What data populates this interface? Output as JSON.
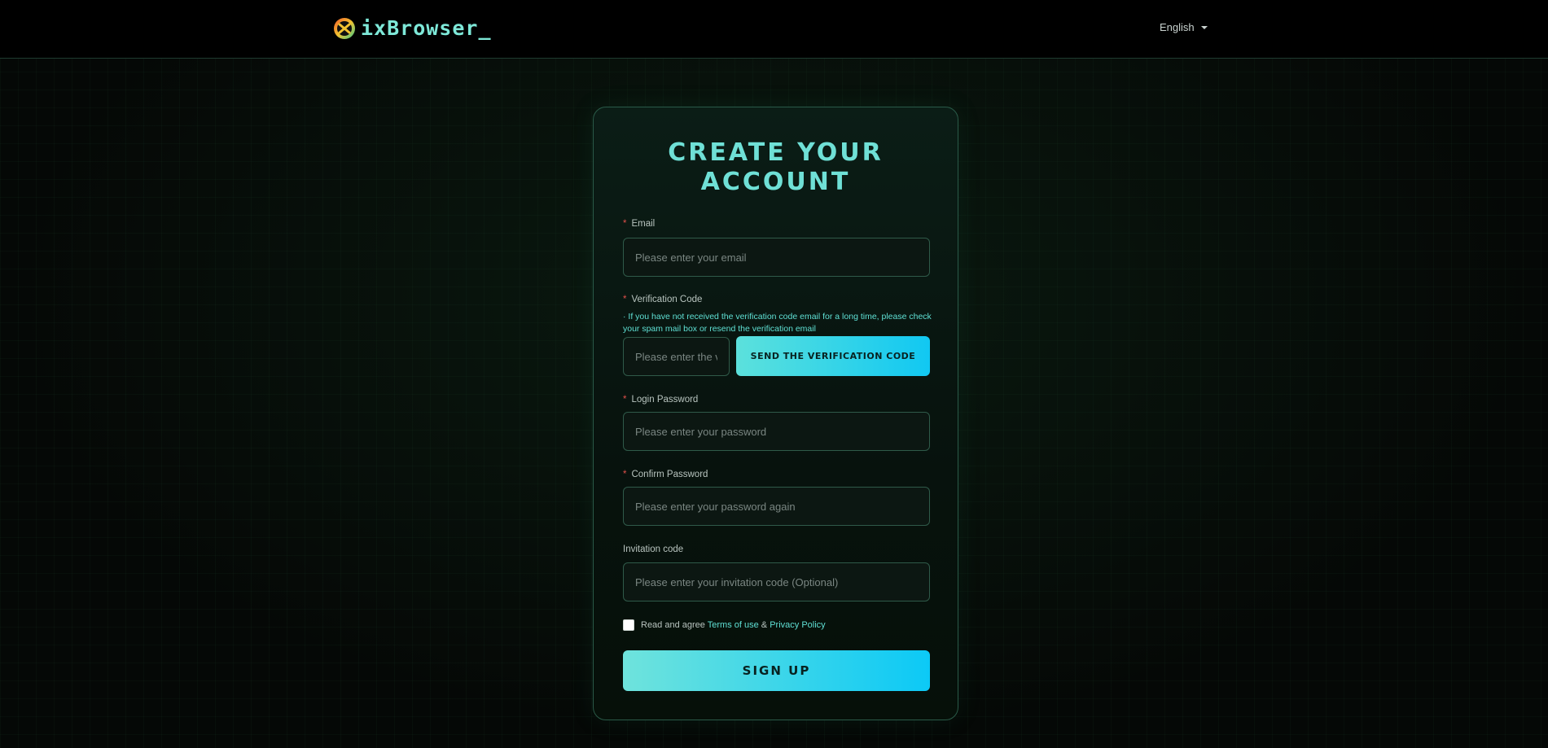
{
  "header": {
    "brand": "ixBrowser_",
    "language": "English"
  },
  "form": {
    "title": "CREATE YOUR\nACCOUNT",
    "email": {
      "label": "Email",
      "placeholder": "Please enter your email",
      "required_mark": "*"
    },
    "verification": {
      "label": "Verification Code",
      "required_mark": "*",
      "hint": "· If you have not received the verification code email for a long time, please check your spam mail box or resend the verification email",
      "placeholder": "Please enter the verification code",
      "send_button": "SEND THE VERIFICATION CODE"
    },
    "password": {
      "label": "Login Password",
      "placeholder": "Please enter your password",
      "required_mark": "*"
    },
    "confirm_password": {
      "label": "Confirm Password",
      "placeholder": "Please enter your password again",
      "required_mark": "*"
    },
    "invitation": {
      "label": "Invitation code",
      "placeholder": "Please enter your invitation code (Optional)"
    },
    "agreement": {
      "prefix": "Read and agree",
      "terms": "Terms of use",
      "separator": "&",
      "privacy": "Privacy Policy",
      "checked": false
    },
    "signup_button": "SIGN UP"
  },
  "colors": {
    "accent": "#6fe0d6",
    "button_gradient_start": "#5ce1dc",
    "button_gradient_end": "#11c8f2",
    "required": "#e0504a",
    "background": "#050806"
  }
}
